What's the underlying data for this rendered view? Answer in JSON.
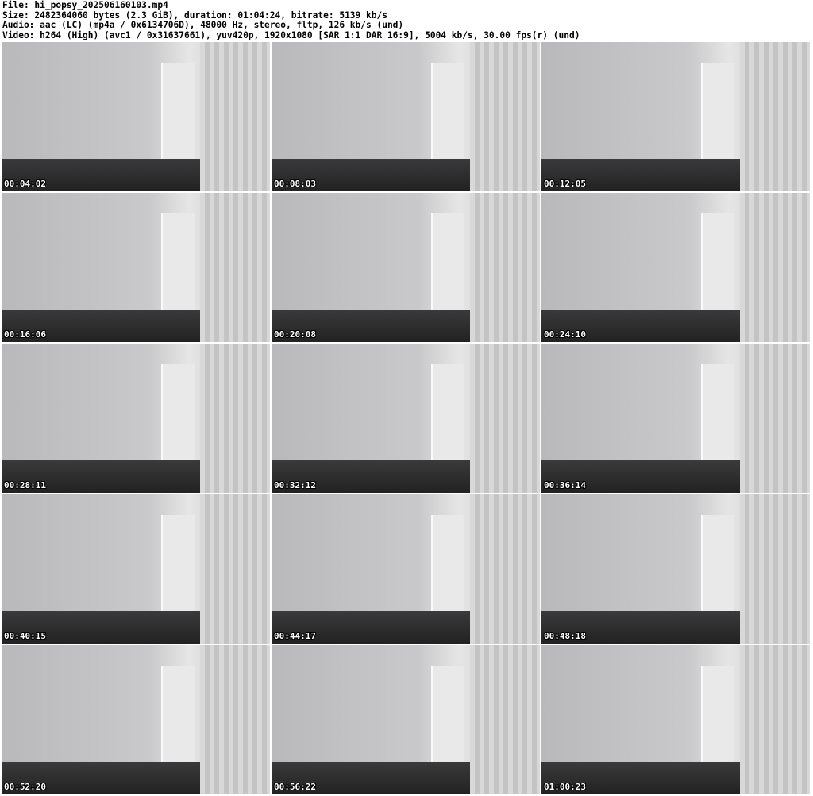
{
  "info": {
    "file": "File: hi_popsy_202506160103.mp4",
    "size": "Size: 2482364060 bytes (2.3 GiB), duration: 01:04:24, bitrate: 5139 kb/s",
    "audio": "Audio: aac (LC) (mp4a / 0x6134706D), 48000 Hz, stereo, fltp, 126 kb/s (und)",
    "video": "Video: h264 (High) (avc1 / 0x31637661), yuv420p, 1920x1080 [SAR 1:1 DAR 16:9], 5004 kb/s, 30.00 fps(r) (und)"
  },
  "thumbnails": [
    {
      "timestamp": "00:04:02"
    },
    {
      "timestamp": "00:08:03"
    },
    {
      "timestamp": "00:12:05"
    },
    {
      "timestamp": "00:16:06"
    },
    {
      "timestamp": "00:20:08"
    },
    {
      "timestamp": "00:24:10"
    },
    {
      "timestamp": "00:28:11"
    },
    {
      "timestamp": "00:32:12"
    },
    {
      "timestamp": "00:36:14"
    },
    {
      "timestamp": "00:40:15"
    },
    {
      "timestamp": "00:44:17"
    },
    {
      "timestamp": "00:48:18"
    },
    {
      "timestamp": "00:52:20"
    },
    {
      "timestamp": "00:56:22"
    },
    {
      "timestamp": "01:00:23"
    }
  ]
}
